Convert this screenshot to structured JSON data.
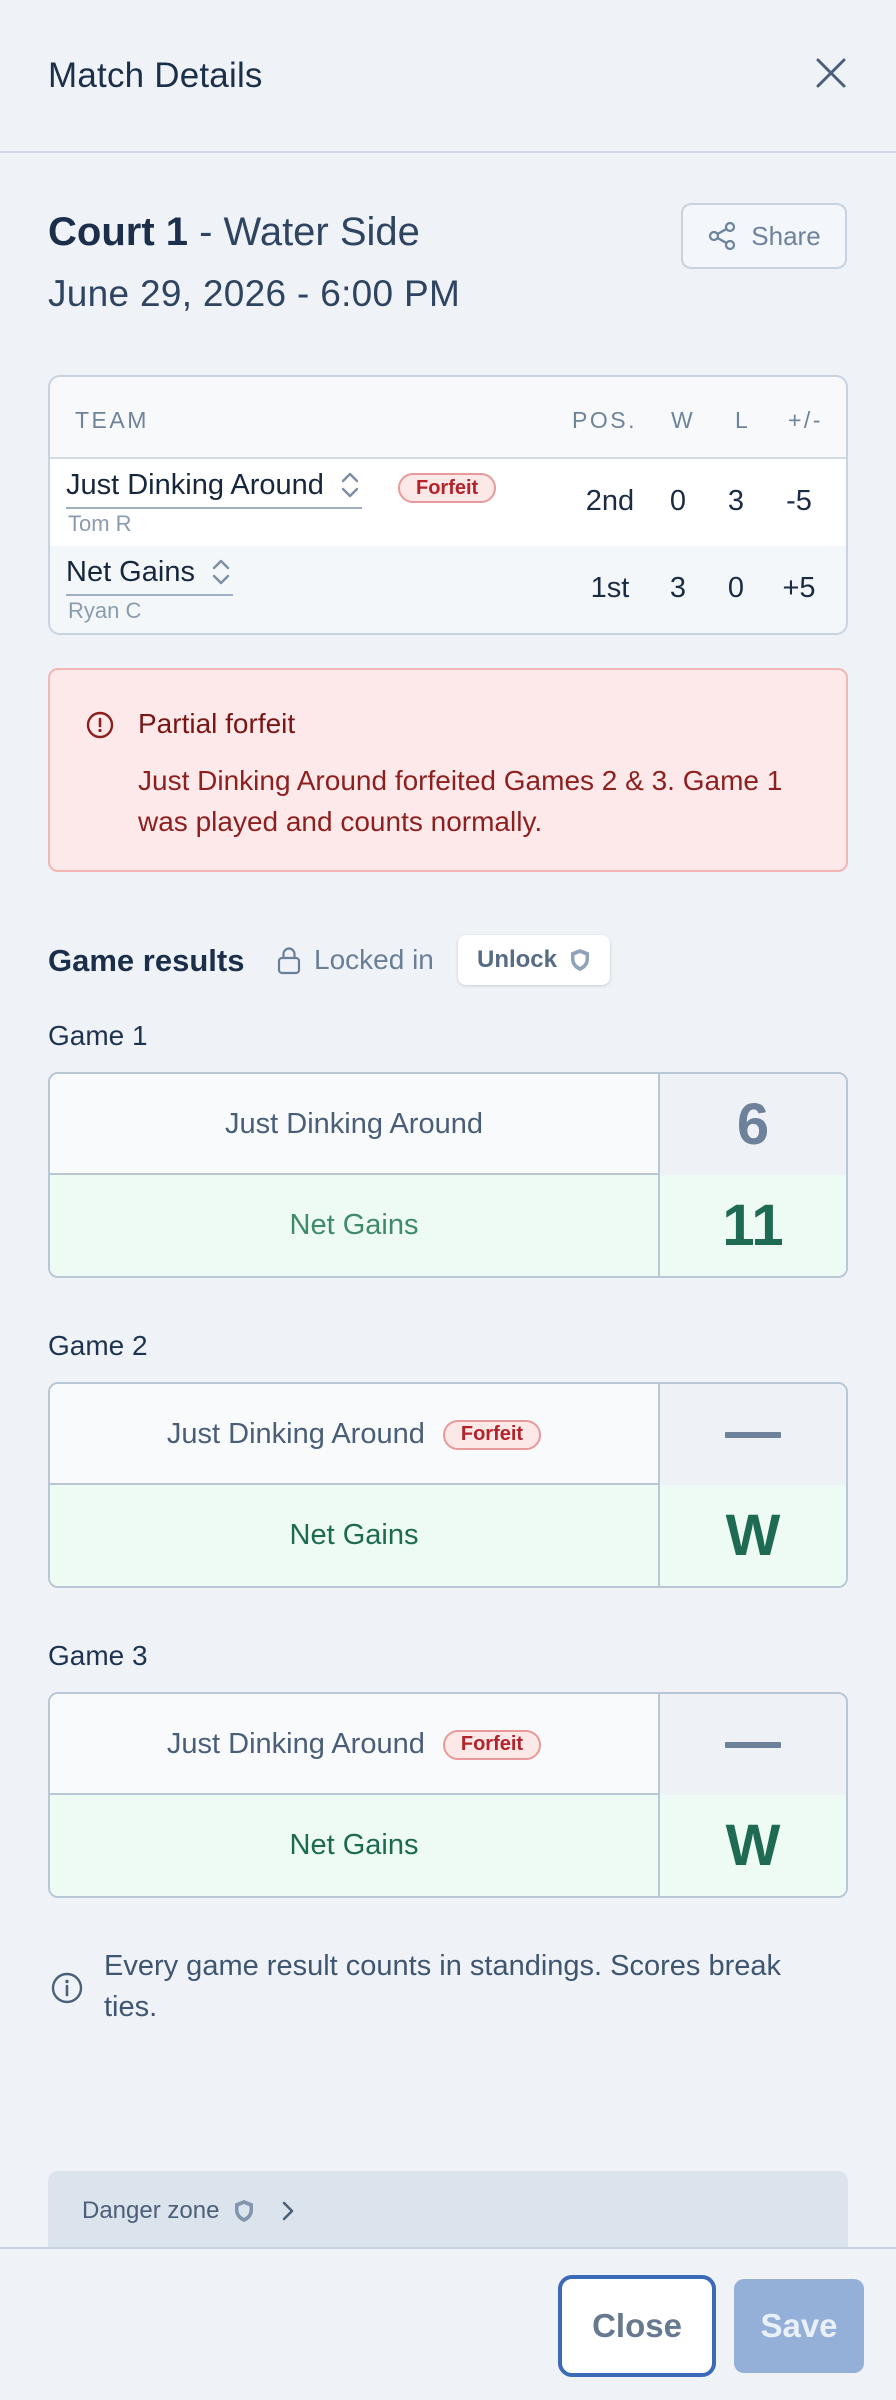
{
  "header": {
    "title": "Match Details"
  },
  "match": {
    "court_bold": "Court 1",
    "court_sub": " - Water Side",
    "date": "June 29, 2026 - 6:00 PM",
    "share_label": "Share"
  },
  "standings": {
    "headers": {
      "team": "TEAM",
      "pos": "POS.",
      "w": "W",
      "l": "L",
      "pm": "+/-"
    },
    "rows": [
      {
        "team": "Just Dinking Around",
        "captain": "Tom R",
        "badge": "Forfeit",
        "pos": "2nd",
        "w": "0",
        "l": "3",
        "pm": "-5"
      },
      {
        "team": "Net Gains",
        "captain": "Ryan C",
        "pos": "1st",
        "w": "3",
        "l": "0",
        "pm": "+5"
      }
    ]
  },
  "alert": {
    "title": "Partial forfeit",
    "body": "Just Dinking Around forfeited Games 2 & 3. Game 1 was played and counts normally."
  },
  "results": {
    "title": "Game results",
    "locked_label": "Locked in",
    "unlock_label": "Unlock",
    "games": [
      {
        "label": "Game 1",
        "top_team": "Just Dinking Around",
        "top_score": "6",
        "bottom_team": "Net Gains",
        "bottom_score": "11"
      },
      {
        "label": "Game 2",
        "top_team": "Just Dinking Around",
        "top_badge": "Forfeit",
        "top_score": "—",
        "bottom_team": "Net Gains",
        "bottom_score": "W"
      },
      {
        "label": "Game 3",
        "top_team": "Just Dinking Around",
        "top_badge": "Forfeit",
        "top_score": "—",
        "bottom_team": "Net Gains",
        "bottom_score": "W"
      }
    ]
  },
  "note": "Every game result counts in standings. Scores break ties.",
  "danger_zone": {
    "label": "Danger zone"
  },
  "footer": {
    "close_label": "Close",
    "save_label": "Save"
  },
  "icons": [
    "close-icon",
    "share-icon",
    "chevron-up-down-icon",
    "alert-circle-icon",
    "lock-icon",
    "shield-icon",
    "info-icon",
    "chevron-right-icon"
  ]
}
